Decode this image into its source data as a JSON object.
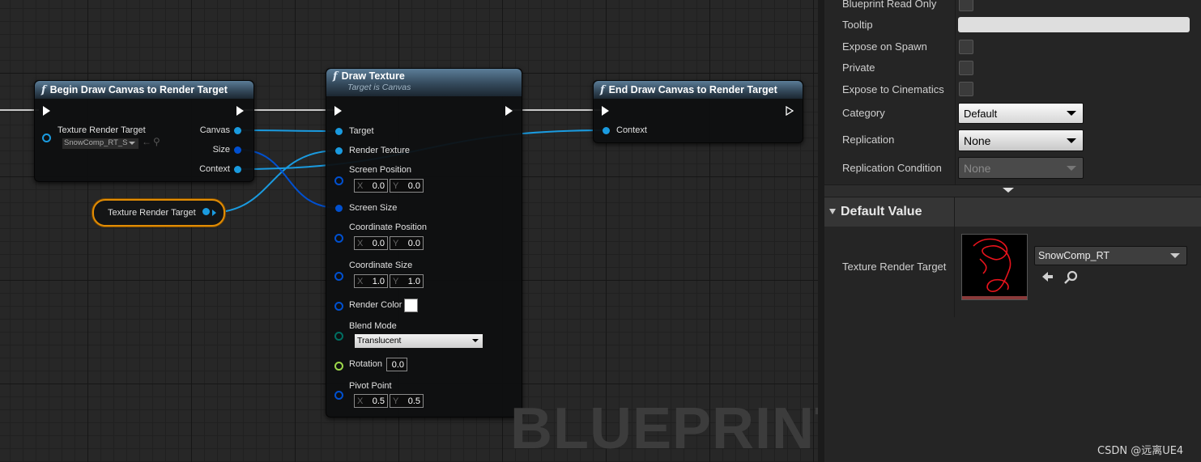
{
  "graph": {
    "watermark": "BLUEPRINT",
    "begin_node": {
      "title": "Begin Draw Canvas to Render Target",
      "in_pin": "Texture Render Target",
      "default_value": "SnowComp_RT_S",
      "out_pins": [
        "Canvas",
        "Size",
        "Context"
      ]
    },
    "var_node": {
      "label": "Texture Render Target"
    },
    "draw_node": {
      "title": "Draw Texture",
      "subtitle": "Target is Canvas",
      "pins": {
        "target": "Target",
        "render_texture": "Render Texture",
        "screen_position": "Screen Position",
        "screen_size": "Screen Size",
        "coordinate_position": "Coordinate Position",
        "coordinate_size": "Coordinate Size",
        "render_color": "Render Color",
        "blend_mode": "Blend Mode",
        "rotation": "Rotation",
        "pivot_point": "Pivot Point"
      },
      "axis_x": "X",
      "axis_y": "Y",
      "screen_position": {
        "x": "0.0",
        "y": "0.0"
      },
      "coordinate_position": {
        "x": "0.0",
        "y": "0.0"
      },
      "coordinate_size": {
        "x": "1.0",
        "y": "1.0"
      },
      "blend_mode_value": "Translucent",
      "rotation_value": "0.0",
      "pivot_point": {
        "x": "0.5",
        "y": "0.5"
      }
    },
    "end_node": {
      "title": "End Draw Canvas to Render Target",
      "in_pin": "Context"
    }
  },
  "details": {
    "blueprint_read_only": "Blueprint Read Only",
    "tooltip": "Tooltip",
    "expose_on_spawn": "Expose on Spawn",
    "private": "Private",
    "expose_to_cinematics": "Expose to Cinematics",
    "category": {
      "label": "Category",
      "value": "Default"
    },
    "replication": {
      "label": "Replication",
      "value": "None"
    },
    "replication_condition": {
      "label": "Replication Condition",
      "value": "None"
    },
    "default_value_header": "Default Value",
    "texture_render_target": {
      "label": "Texture Render Target",
      "asset": "SnowComp_RT"
    }
  },
  "credit": "CSDN @远离UE4",
  "colors": {
    "object_pin": "#1a9be0",
    "struct_pin": "#0050d0",
    "float_pin": "#9ed84a",
    "enum_pin": "#006e62",
    "selected": "#e18c05"
  }
}
